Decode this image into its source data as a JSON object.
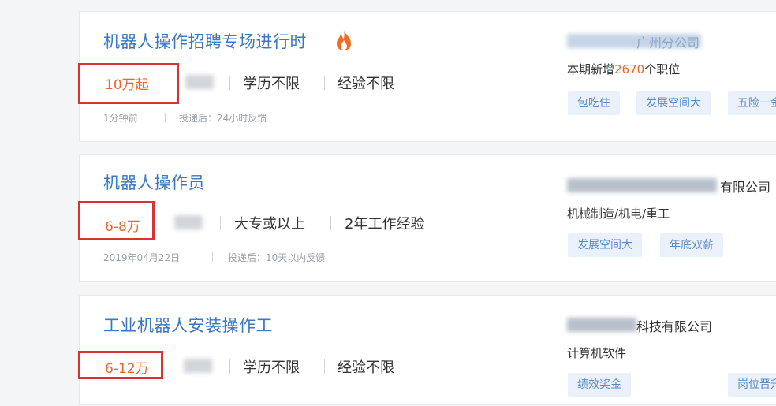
{
  "jobs": [
    {
      "title": "机器人操作招聘专场进行时",
      "has_fire_icon": true,
      "salary": "10万起",
      "requirements": [
        "学历不限",
        "经验不限"
      ],
      "meta": [
        "1分钟前",
        "投递后：24小时反馈"
      ],
      "company": "广州分公司",
      "industry_prefix": "本期新增",
      "industry_number": "2670",
      "industry_suffix": "个职位",
      "tags": [
        "包吃住",
        "发展空间大",
        "五险一金"
      ]
    },
    {
      "title": "机器人操作员",
      "has_fire_icon": false,
      "salary": "6-8万",
      "requirements": [
        "大专或以上",
        "2年工作经验"
      ],
      "meta": [
        "2019年04月22日",
        "投递后：10天以内反馈"
      ],
      "company": "有限公司",
      "industry": "机械制造/机电/重工",
      "tags": [
        "发展空间大",
        "年底双薪"
      ]
    },
    {
      "title": "工业机器人安装操作工",
      "has_fire_icon": false,
      "salary": "6-12万",
      "requirements": [
        "学历不限",
        "经验不限"
      ],
      "company": "科技有限公司",
      "industry": "计算机软件",
      "tags": [
        "绩效奖金",
        "岗位晋升"
      ]
    }
  ],
  "colors": {
    "title": "#3a78c3",
    "salary": "#f0632c",
    "highlight_box": "#d63433",
    "tag_bg": "#eaf1fa",
    "tag_text": "#5a8ac2"
  }
}
